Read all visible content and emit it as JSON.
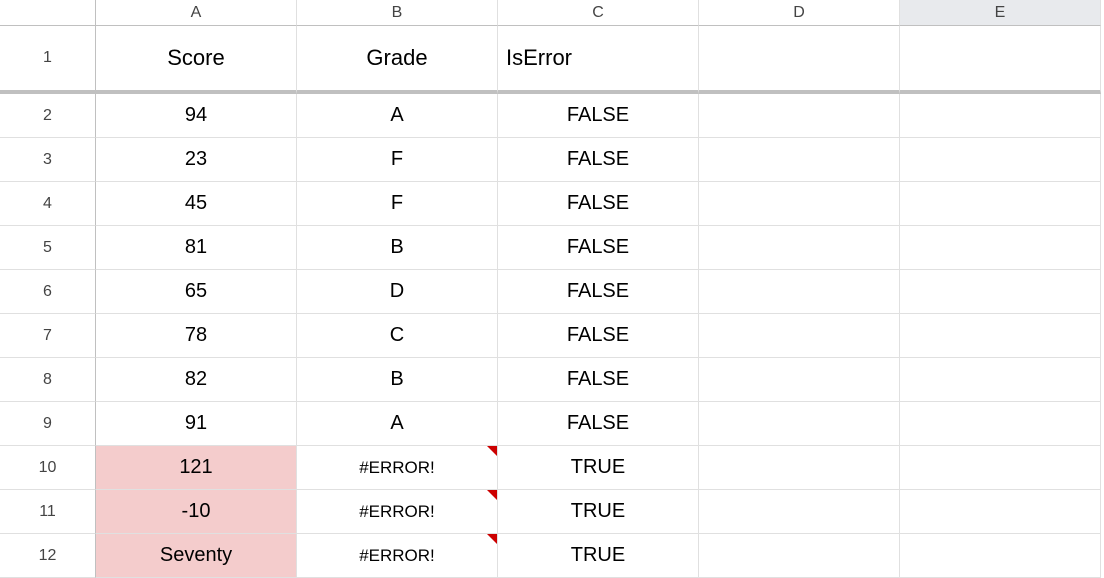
{
  "columns": [
    "A",
    "B",
    "C",
    "D",
    "E"
  ],
  "selected_column": "E",
  "rows": [
    {
      "num": 1,
      "cells": {
        "A": "Score",
        "B": "Grade",
        "C": "IsError",
        "D": "",
        "E": ""
      },
      "header": true,
      "c_align_left": true
    },
    {
      "num": 2,
      "cells": {
        "A": "94",
        "B": "A",
        "C": "FALSE",
        "D": "",
        "E": ""
      }
    },
    {
      "num": 3,
      "cells": {
        "A": "23",
        "B": "F",
        "C": "FALSE",
        "D": "",
        "E": ""
      }
    },
    {
      "num": 4,
      "cells": {
        "A": "45",
        "B": "F",
        "C": "FALSE",
        "D": "",
        "E": ""
      }
    },
    {
      "num": 5,
      "cells": {
        "A": "81",
        "B": "B",
        "C": "FALSE",
        "D": "",
        "E": ""
      }
    },
    {
      "num": 6,
      "cells": {
        "A": "65",
        "B": "D",
        "C": "FALSE",
        "D": "",
        "E": ""
      }
    },
    {
      "num": 7,
      "cells": {
        "A": "78",
        "B": "C",
        "C": "FALSE",
        "D": "",
        "E": ""
      }
    },
    {
      "num": 8,
      "cells": {
        "A": "82",
        "B": "B",
        "C": "FALSE",
        "D": "",
        "E": ""
      }
    },
    {
      "num": 9,
      "cells": {
        "A": "91",
        "B": "A",
        "C": "FALSE",
        "D": "",
        "E": ""
      }
    },
    {
      "num": 10,
      "cells": {
        "A": "121",
        "B": "#ERROR!",
        "C": "TRUE",
        "D": "",
        "E": ""
      },
      "a_highlight": true,
      "b_error": true
    },
    {
      "num": 11,
      "cells": {
        "A": "-10",
        "B": "#ERROR!",
        "C": "TRUE",
        "D": "",
        "E": ""
      },
      "a_highlight": true,
      "b_error": true
    },
    {
      "num": 12,
      "cells": {
        "A": "Seventy",
        "B": "#ERROR!",
        "C": "TRUE",
        "D": "",
        "E": ""
      },
      "a_highlight": true,
      "b_error": true
    }
  ]
}
